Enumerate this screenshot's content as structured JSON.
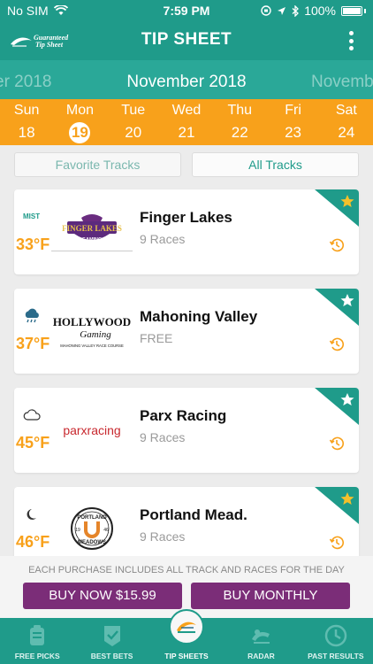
{
  "status": {
    "carrier": "No SIM",
    "time": "7:59 PM",
    "battery": "100%"
  },
  "nav": {
    "logo_text": "Guaranteed Tip Sheet",
    "title": "TIP SHEET"
  },
  "month": {
    "prev": "er 2018",
    "current": "November 2018",
    "next": "Novemb"
  },
  "days": [
    {
      "name": "Sun",
      "num": "18"
    },
    {
      "name": "Mon",
      "num": "19",
      "selected": true
    },
    {
      "name": "Tue",
      "num": "20"
    },
    {
      "name": "Wed",
      "num": "21"
    },
    {
      "name": "Thu",
      "num": "22"
    },
    {
      "name": "Fri",
      "num": "23"
    },
    {
      "name": "Sat",
      "num": "24"
    }
  ],
  "segmented": {
    "favorite": "Favorite Tracks",
    "all": "All Tracks"
  },
  "cards": [
    {
      "name": "Finger Lakes",
      "sub": "9 Races",
      "temp": "33°F",
      "weather": "MIST",
      "logo_text": "FINGER LAKES",
      "logo_sub": "GAMING",
      "starred": true
    },
    {
      "name": "Mahoning Valley",
      "sub": "FREE",
      "temp": "37°F",
      "weather": "",
      "logo_text": "HOLLYWOOD",
      "logo_sub": "Gaming",
      "logo_sub2": "MAHONING VALLEY RACE COURSE",
      "starred": false
    },
    {
      "name": "Parx Racing",
      "sub": "9 Races",
      "temp": "45°F",
      "weather": "",
      "logo_text": "parxracing",
      "starred": false
    },
    {
      "name": "Portland Mead.",
      "sub": "9 Races",
      "temp": "46°F",
      "weather": "",
      "logo_text": "PORTLAND",
      "logo_sub": "MEADOWS",
      "logo_left": "19",
      "logo_right": "46",
      "starred": true
    }
  ],
  "purchase": {
    "note": "EACH PURCHASE INCLUDES ALL TRACK AND RACES FOR THE DAY",
    "buy_now": "BUY NOW $15.99",
    "buy_monthly": "BUY MONTHLY"
  },
  "tabs": [
    {
      "label": "FREE PICKS",
      "icon": "free-picks-icon"
    },
    {
      "label": "BEST BETS",
      "icon": "best-bets-icon"
    },
    {
      "label": "TIP SHEETS",
      "icon": "tip-sheets-icon"
    },
    {
      "label": "RADAR",
      "icon": "radar-icon"
    },
    {
      "label": "PAST RESULTS",
      "icon": "past-results-icon"
    }
  ],
  "colors": {
    "teal": "#1f9b8a",
    "orange": "#f8a11b",
    "purple": "#7b2d78",
    "star_filled": "#f5c02b"
  }
}
